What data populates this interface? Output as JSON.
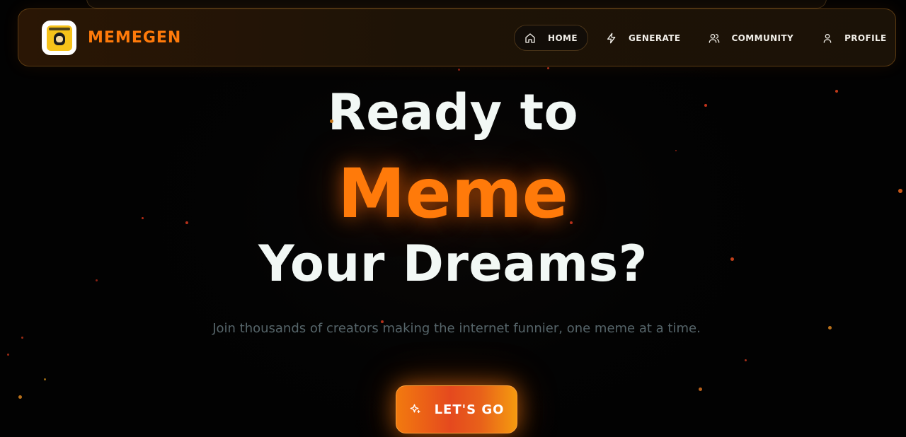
{
  "brand": {
    "name": "MEMEGEN",
    "logo_icon": "meme-logo-icon"
  },
  "nav": {
    "items": [
      {
        "label": "HOME",
        "icon": "home-icon",
        "active": true
      },
      {
        "label": "GENERATE",
        "icon": "lightning-icon",
        "active": false
      },
      {
        "label": "COMMUNITY",
        "icon": "users-icon",
        "active": false
      },
      {
        "label": "PROFILE",
        "icon": "user-icon",
        "active": false
      }
    ]
  },
  "hero": {
    "line1": "Ready to",
    "line2": "Meme",
    "line3": "Your Dreams?",
    "subtitle": "Join thousands of creators making the internet funnier, one meme at a time.",
    "cta_label": "LET'S GO",
    "cta_icon": "sparkle-icon"
  },
  "colors": {
    "accent": "#ff7a0a",
    "background": "#020202",
    "headline": "#f2f8f5",
    "subtitle": "#56656a",
    "nav_border": "#5c3b12"
  }
}
